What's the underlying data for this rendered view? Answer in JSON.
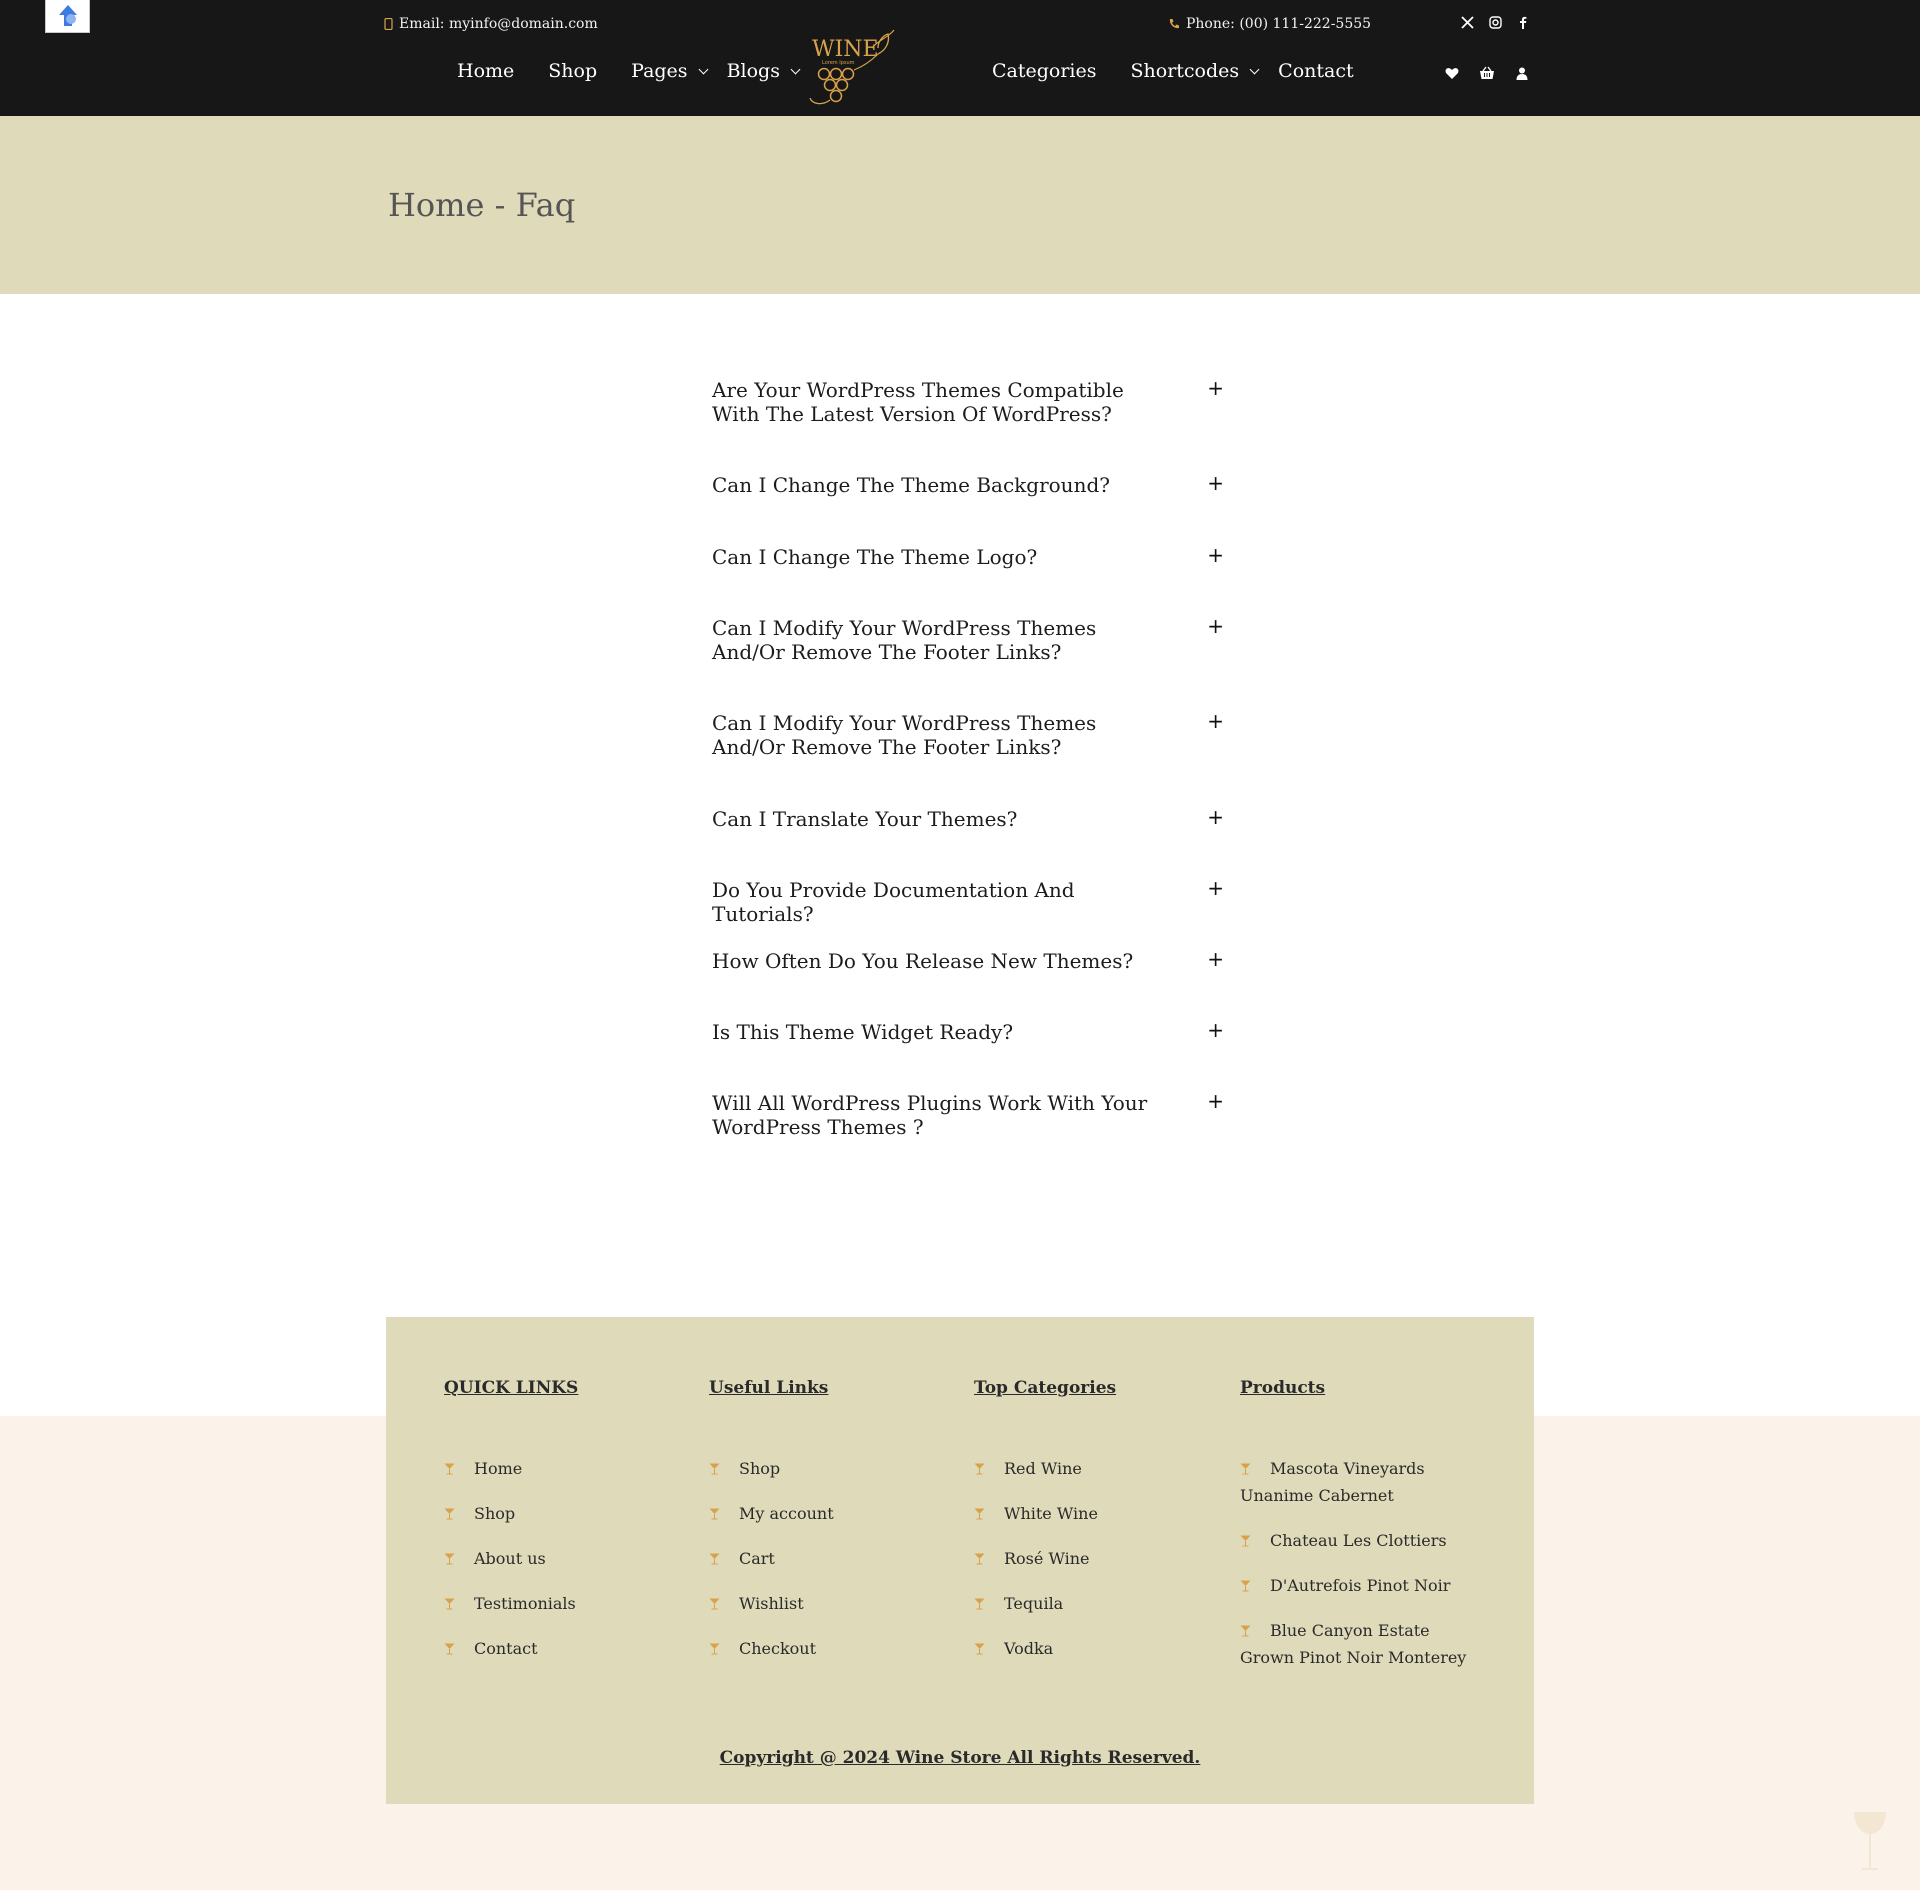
{
  "header": {
    "email_text": "Email: myinfo@domain.com",
    "phone_text": "Phone: (00) 111-222-5555",
    "nav_left": [
      {
        "label": "Home"
      },
      {
        "label": "Shop"
      },
      {
        "label": "Pages"
      },
      {
        "label": "Blogs"
      }
    ],
    "nav_right": [
      {
        "label": "Categories"
      },
      {
        "label": "Shortcodes"
      },
      {
        "label": "Contact"
      }
    ],
    "logo_text": "WINE",
    "logo_subtext": "Lorem Ipsum",
    "social_icons": [
      "x-icon",
      "instagram-icon",
      "facebook-icon"
    ],
    "action_icons": [
      "heart-icon",
      "basket-icon",
      "user-icon"
    ]
  },
  "page": {
    "title": "Home - Faq"
  },
  "faq": {
    "items": [
      {
        "question": "Are Your WordPress Themes Compatible With The Latest Version Of WordPress?",
        "toggle": "+"
      },
      {
        "question": "Can I Change The Theme Background?",
        "toggle": "+"
      },
      {
        "question": "Can I Change The Theme Logo?",
        "toggle": "+"
      },
      {
        "question": "Can I Modify Your WordPress Themes And/Or Remove The Footer Links?",
        "toggle": "+"
      },
      {
        "question": "Can I Modify Your WordPress Themes And/Or Remove The Footer Links?",
        "toggle": "+"
      },
      {
        "question": "Can I Translate Your Themes?",
        "toggle": "+"
      },
      {
        "question": "Do You Provide Documentation And Tutorials?",
        "toggle": "+"
      },
      {
        "question": "How Often Do You Release New Themes?",
        "toggle": "+"
      },
      {
        "question": "Is This Theme Widget Ready?",
        "toggle": "+"
      },
      {
        "question": "Will All WordPress Plugins Work With Your WordPress Themes ?",
        "toggle": "+"
      }
    ]
  },
  "footer": {
    "columns": [
      {
        "heading": "QUICK LINKS",
        "links": [
          "Home",
          "Shop",
          "About us",
          "Testimonials",
          "Contact"
        ]
      },
      {
        "heading": "Useful Links",
        "links": [
          "Shop",
          "My account",
          "Cart",
          "Wishlist",
          "Checkout"
        ]
      },
      {
        "heading": "Top Categories",
        "links": [
          "Red Wine",
          "White Wine",
          "Rosé Wine",
          "Tequila",
          "Vodka"
        ]
      },
      {
        "heading": "Products",
        "links": [
          "Mascota Vineyards Unanime Cabernet",
          "Chateau Les Clottiers",
          "D'Autrefois Pinot Noir",
          "Blue Canyon Estate Grown Pinot Noir Monterey"
        ]
      }
    ],
    "copyright": "Copyright @ 2024 Wine Store All Rights Reserved."
  },
  "colors": {
    "header_bg": "#171717",
    "band_bg": "#dfdab9",
    "footer_bg": "#fbf2e9",
    "accent_gold": "#d9a24a"
  }
}
